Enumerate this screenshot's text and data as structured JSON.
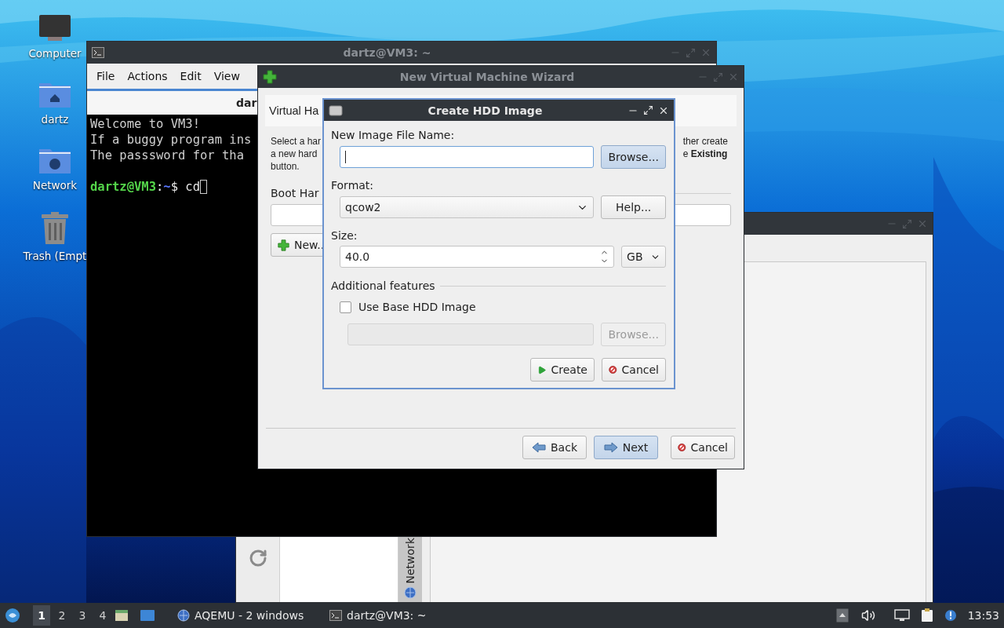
{
  "desktop_icons": [
    {
      "label": "Computer",
      "kind": "computer"
    },
    {
      "label": "dartz",
      "kind": "home"
    },
    {
      "label": "Network",
      "kind": "network"
    },
    {
      "label": "Trash (Empt",
      "kind": "trash"
    }
  ],
  "main_window": {
    "side_tab": "Network"
  },
  "terminal": {
    "title": "dartz@VM3: ~",
    "menu": [
      "File",
      "Actions",
      "Edit",
      "View"
    ],
    "tab": "dar",
    "lines": [
      "Welcome to VM3!",
      "If a buggy program ins",
      "The passsword for tha"
    ],
    "prompt": {
      "user": "dartz@VM3",
      "sep": ":",
      "path": "~",
      "command": "$ cd"
    }
  },
  "wizard": {
    "title": "New Virtual Machine Wizard",
    "header": "Virtual Ha",
    "intro_left": [
      "Select a har",
      "a new hard",
      "button."
    ],
    "intro_right": [
      "ther create",
      "e **Existing**"
    ],
    "boot_label": "Boot Har",
    "new_button": "New..",
    "buttons": [
      {
        "label": "Back",
        "kind": "back",
        "default": false
      },
      {
        "label": "Next",
        "kind": "next",
        "default": true
      },
      {
        "label": "Cancel",
        "kind": "cancel",
        "default": false
      }
    ]
  },
  "dialog": {
    "title": "Create HDD Image",
    "file_label": "New Image File Name:",
    "file_field": {
      "focused": true
    },
    "browse_button": {
      "label": "Browse...",
      "default": true
    },
    "format_label": "Format:",
    "format": "qcow2",
    "help_button": "Help...",
    "size_label": "Size:",
    "size": "40.0",
    "unit": "GB",
    "features_label": "Additional features",
    "base_image": {
      "label": "Use Base HDD Image",
      "checked": false
    },
    "base_path": {
      "disabled": true
    },
    "base_browse": {
      "label": "Browse...",
      "disabled": true
    },
    "buttons": [
      {
        "label": "Create",
        "kind": "create"
      },
      {
        "label": "Cancel",
        "kind": "cancel"
      }
    ]
  },
  "taskbar": {
    "workspaces": [
      {
        "label": "1",
        "selected": true
      },
      {
        "label": "2",
        "selected": false
      },
      {
        "label": "3",
        "selected": false
      },
      {
        "label": "4",
        "selected": false
      }
    ],
    "tasks": [
      {
        "label": "AQEMU - 2 windows",
        "kind": "aqemu"
      },
      {
        "label": "dartz@VM3: ~",
        "kind": "terminal"
      }
    ],
    "clock": "13:53"
  }
}
